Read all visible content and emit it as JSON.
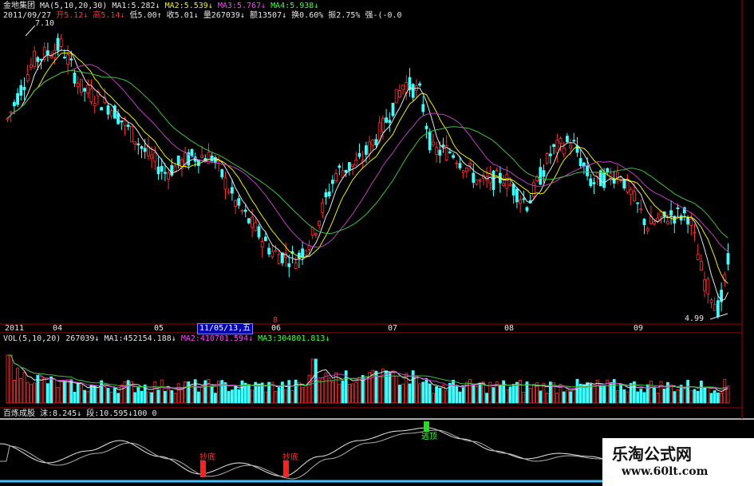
{
  "header": {
    "stock_name": "金地集团",
    "ma_params": "MA(5,10,20,30)",
    "ma1": "MA1:5.282↓",
    "ma2": "MA2:5.539↓",
    "ma3": "MA3:5.767↓",
    "ma4": "MA4:5.938↓",
    "date": "2011/09/27",
    "open": "开5.12↓",
    "high": "高5.14↓",
    "low": "低5.00↑",
    "close": "收5.01↓",
    "volume": "量267039↓",
    "amount": "额13507↓",
    "turnover": "换0.60%",
    "amplitude": "振2.75%",
    "strength": "强-(-0.0"
  },
  "price_labels": {
    "max": "7.10",
    "min": "4.99"
  },
  "time_axis": {
    "labels": [
      "2011",
      "04",
      "05",
      "06",
      "07",
      "08",
      "09"
    ],
    "cursor_date": "11/05/13,五",
    "cursor_marker": "8"
  },
  "vol_header": {
    "params": "VOL(5,10,20)",
    "vol": "267039↓",
    "ma1": "MA1:452154.188↓",
    "ma2": "MA2:410701.594↓",
    "ma3": "MA3:304801.813↓"
  },
  "indicator_header": {
    "name": "百炼成股",
    "kuo": "沫:8.245↓",
    "duan": "段:10.595↓100",
    "zero": "0"
  },
  "signals": {
    "bottom1": "抄底",
    "bottom2": "抄底",
    "escape": "逃顶"
  },
  "brand": {
    "title": "乐淘公式网",
    "url": "www.60lt.com"
  },
  "colors": {
    "up": "#ff3030",
    "down": "#40ffff",
    "ma1": "#e6e6e6",
    "ma2": "#f0f000",
    "ma3": "#c040c0",
    "ma4": "#40c040"
  }
}
